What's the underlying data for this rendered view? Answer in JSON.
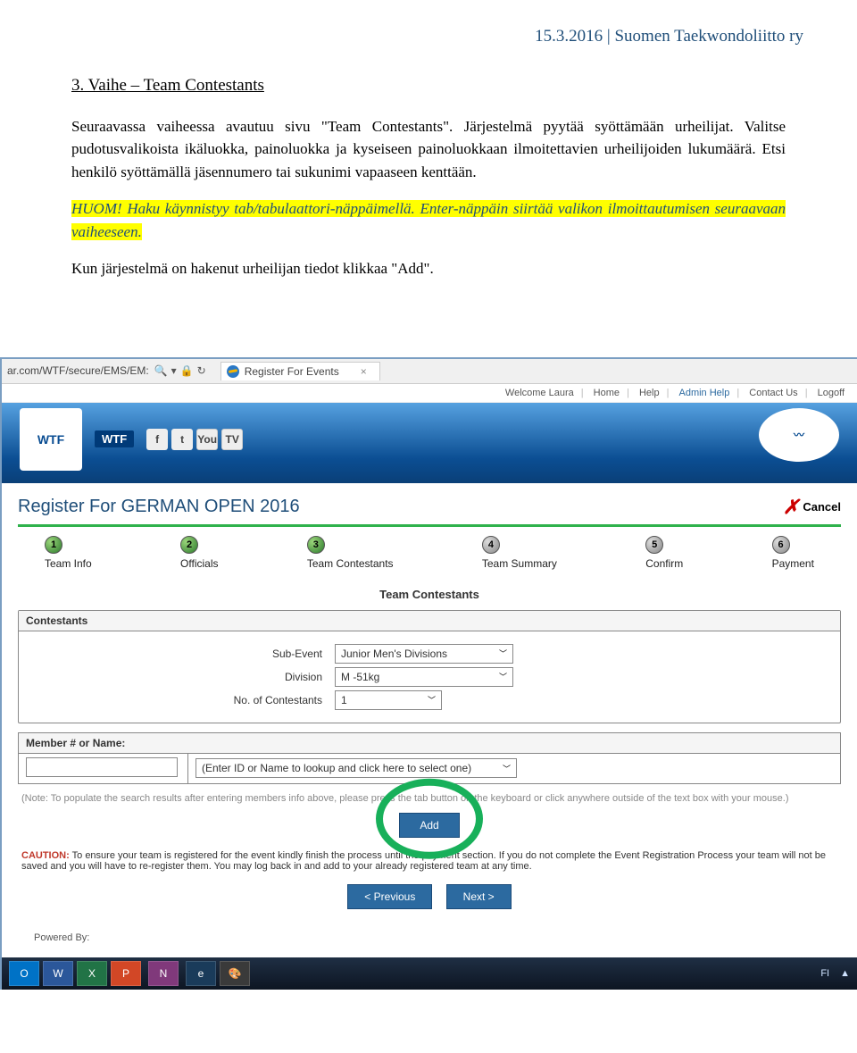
{
  "header": {
    "date_org": "15.3.2016 | Suomen Taekwondoliitto ry"
  },
  "doc": {
    "title": "3.  Vaihe – Team Contestants",
    "p1": "Seuraavassa vaiheessa avautuu sivu \"Team Contestants\". Järjestelmä pyytää syöttämään urheilijat. Valitse pudotusvalikoista ikäluokka, painoluokka ja kyseiseen painoluokkaan ilmoitettavien urheilijoiden lukumäärä. Etsi henkilö syöttämällä jäsennumero tai sukunimi vapaaseen kenttään.",
    "hl1": "HUOM! Haku käynnistyy tab/tabulaattori-näppäimellä. Enter-näppäin siirtää valikon ilmoittautumisen seuraavaan vaiheeseen.",
    "p2": "Kun järjestelmä on hakenut urheilijan tiedot klikkaa \"Add\"."
  },
  "browser": {
    "url_fragment": "ar.com/WTF/secure/EMS/EM:",
    "search_glyph": "🔍",
    "lock_glyph": "🔒",
    "refresh_glyph": "↻",
    "tab_title": "Register For Events",
    "tab_close": "×"
  },
  "toplinks": {
    "welcome": "Welcome Laura",
    "home": "Home",
    "help": "Help",
    "admin_help": "Admin Help",
    "contact": "Contact Us",
    "logoff": "Logoff"
  },
  "banner": {
    "wtf": "WTF",
    "fb": "f",
    "tw": "t",
    "yt": "You",
    "tv": "TV"
  },
  "reg": {
    "title": "Register For GERMAN OPEN 2016",
    "cancel": "Cancel"
  },
  "steps": [
    {
      "n": "1",
      "label": "Team Info",
      "active": true
    },
    {
      "n": "2",
      "label": "Officials",
      "active": true
    },
    {
      "n": "3",
      "label": "Team Contestants",
      "active": true
    },
    {
      "n": "4",
      "label": "Team Summary",
      "active": false
    },
    {
      "n": "5",
      "label": "Confirm",
      "active": false
    },
    {
      "n": "6",
      "label": "Payment",
      "active": false
    }
  ],
  "section": {
    "title": "Team Contestants",
    "panel_label": "Contestants",
    "sub_event_label": "Sub-Event",
    "sub_event_value": "Junior Men's Divisions",
    "division_label": "Division",
    "division_value": "M -51kg",
    "num_label": "No. of Contestants",
    "num_value": "1"
  },
  "member": {
    "head": "Member # or Name:",
    "dropdown": "(Enter ID or Name to lookup and click here to select one)",
    "note": "(Note: To populate the search results after entering members info above, please press the tab button on the keyboard or click anywhere outside of the text box with your mouse.)",
    "add": "Add"
  },
  "caution": {
    "label": "CAUTION:",
    "text": " To ensure your team is registered for the event kindly finish the process until the payment section. If you do not complete the Event Registration Process your team will not be saved and you will have to re-register them. You may log back in and add to your already registered team at any time."
  },
  "nav": {
    "prev": "< Previous",
    "next": "Next >"
  },
  "powered": "Powered By:",
  "taskbar": {
    "outlook": "O",
    "word": "W",
    "excel": "X",
    "ppt": "P",
    "note": "N",
    "ie": "e",
    "paint": "🎨",
    "lang": "FI",
    "tray": "▲"
  }
}
